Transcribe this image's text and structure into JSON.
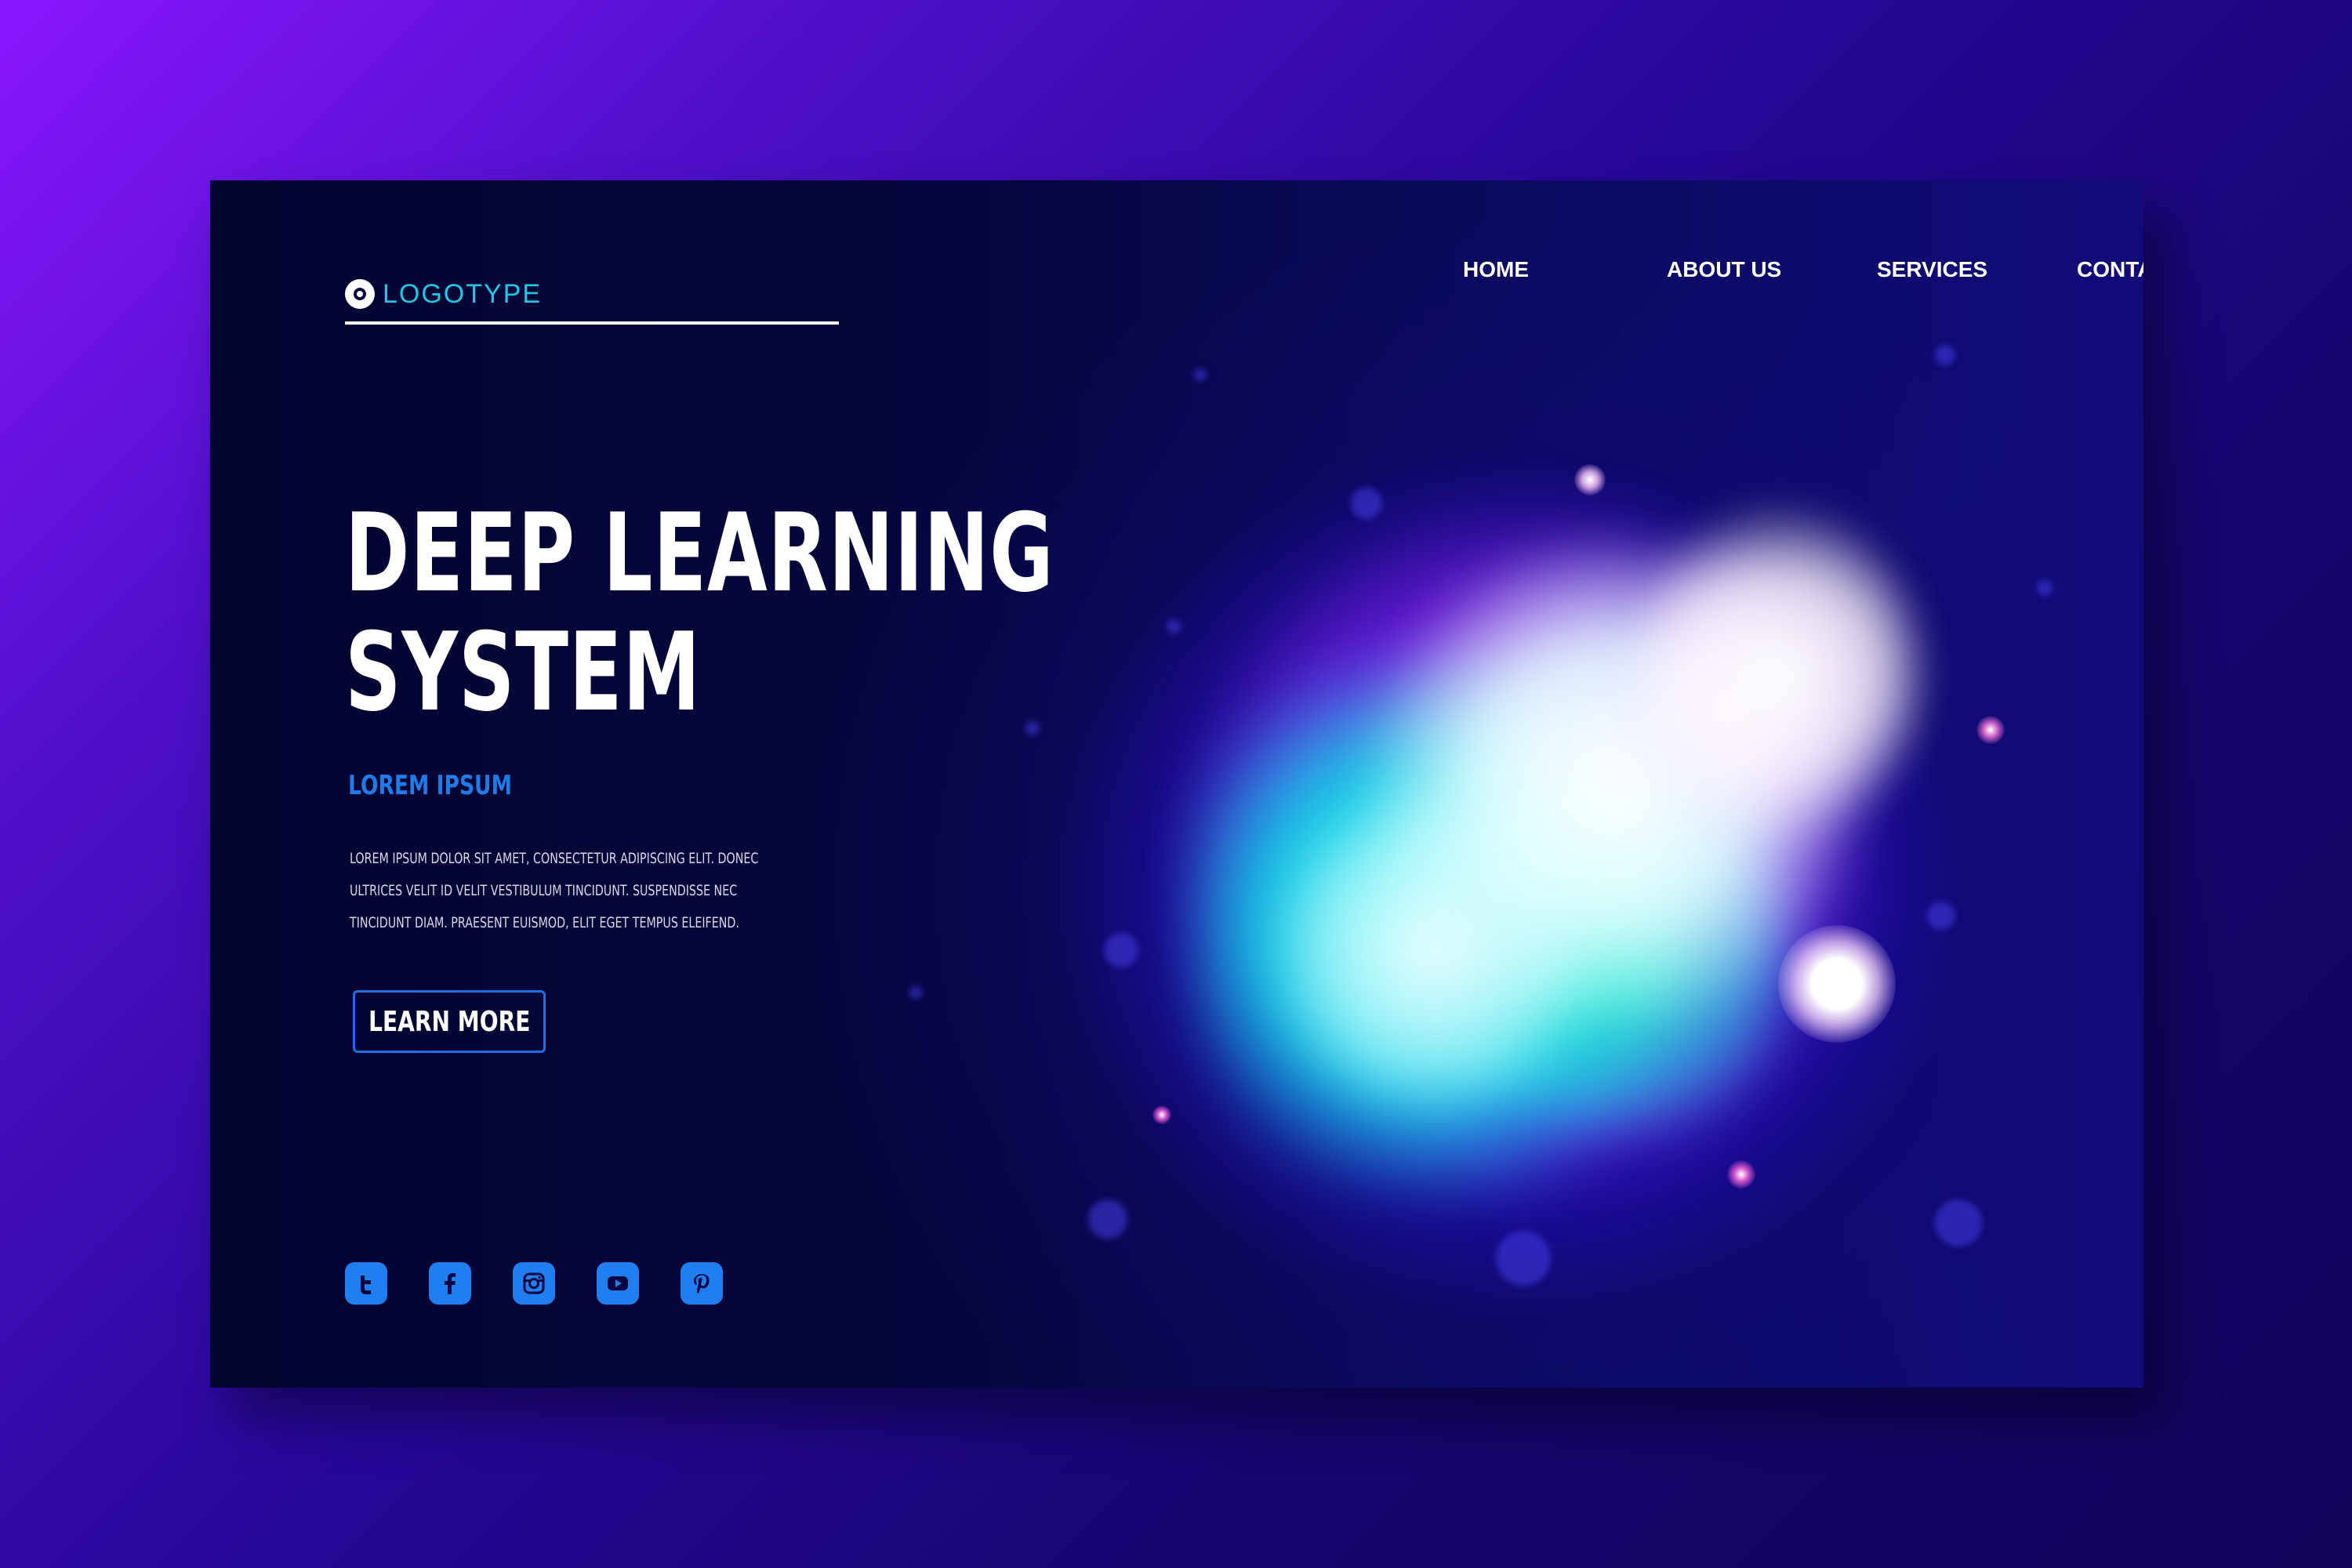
{
  "colors": {
    "background_start": "#8a16ff",
    "background_end": "#10045a",
    "card": "#05053a",
    "accent_blue": "#1e7be8",
    "logo_text": "#1ec8e6",
    "text": "#ffffff"
  },
  "header": {
    "logo": {
      "icon": "circle-target-icon",
      "text": "LOGOTYPE"
    },
    "nav": [
      {
        "label": "HOME"
      },
      {
        "label": "ABOUT US"
      },
      {
        "label": "SERVICES"
      },
      {
        "label": "CONTACT US"
      }
    ]
  },
  "hero": {
    "title_line1": "DEEP LEARNING",
    "title_line2": "SYSTEM",
    "subtitle": "LOREM IPSUM",
    "body_lines": [
      "LOREM IPSUM DOLOR SIT AMET, CONSECTETUR ADIPISCING ELIT. DONEC",
      "ULTRICES VELIT ID VELIT VESTIBULUM TINCIDUNT. SUSPENDISSE NEC",
      "TINCIDUNT DIAM. PRAESENT EUISMOD, ELIT EGET TEMPUS ELEIFEND."
    ],
    "cta_label": "LEARN MORE"
  },
  "social": [
    {
      "icon": "twitter-icon"
    },
    {
      "icon": "facebook-icon"
    },
    {
      "icon": "instagram-icon"
    },
    {
      "icon": "youtube-icon"
    },
    {
      "icon": "pinterest-icon"
    }
  ]
}
